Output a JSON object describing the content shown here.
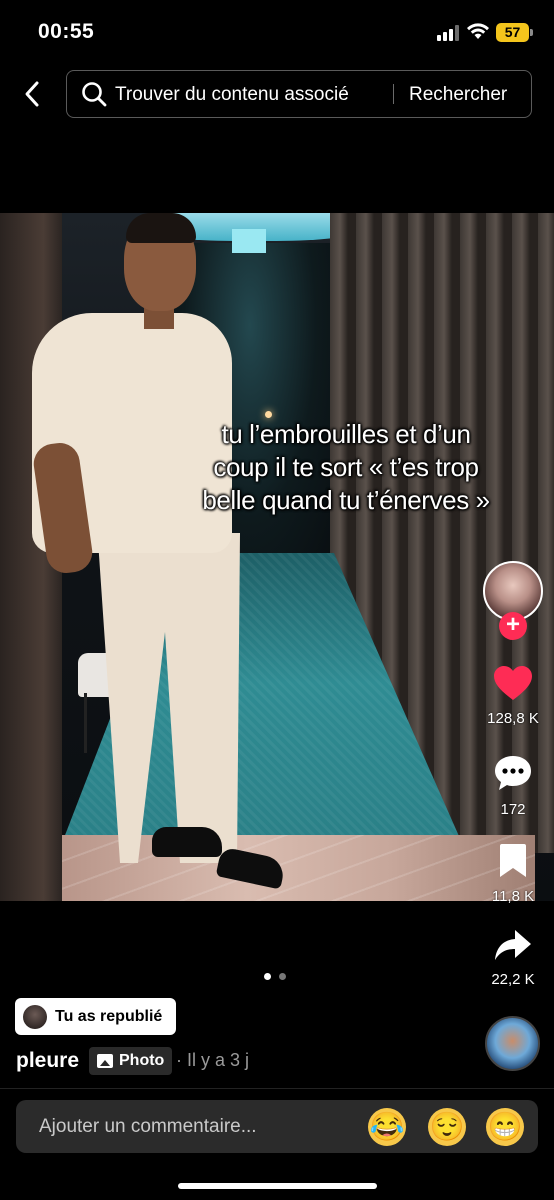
{
  "status_bar": {
    "time": "00:55",
    "battery_level": "57",
    "battery_color": "#f4c51c"
  },
  "search": {
    "back_icon": "chevron-left-icon",
    "search_icon": "search-icon",
    "value": "Trouver du contenu associé",
    "button_label": "Rechercher"
  },
  "post": {
    "caption_lines": [
      "tu l’embrouilles et d’un",
      "coup il te sort « t’es trop",
      "belle quand tu t’énerves »"
    ],
    "carousel": {
      "count": 2,
      "active_index": 0
    }
  },
  "actions": {
    "follow_label": "+",
    "like_count": "128,8 K",
    "comment_count": "172",
    "save_count": "11,8 K",
    "share_count": "22,2 K",
    "like_color": "#fe2c55"
  },
  "info": {
    "republished_label": "Tu as republié",
    "username": "pleure",
    "type_label": "Photo",
    "time_ago": "· Il y a 3 j"
  },
  "comment_bar": {
    "placeholder": "Ajouter un commentaire...",
    "emojis": [
      "😂",
      "😌",
      "😁"
    ]
  }
}
